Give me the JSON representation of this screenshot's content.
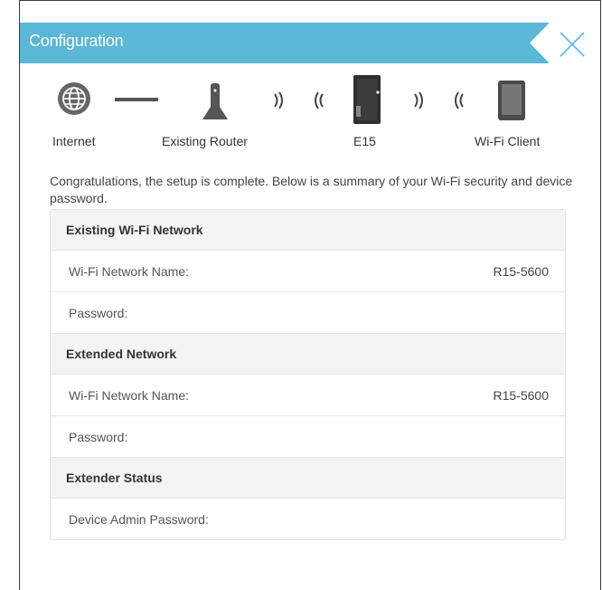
{
  "header": {
    "title": "Configuration"
  },
  "topology": {
    "labels": {
      "internet": "Internet",
      "router": "Existing Router",
      "extender": "E15",
      "client": "Wi-Fi Client"
    },
    "icons": [
      "globe-icon",
      "router-icon",
      "extender-icon",
      "tablet-icon",
      "wifi-signal-icon"
    ]
  },
  "intro": "Congratulations, the setup is complete. Below is a summary of your Wi-Fi security and device password.",
  "sections": {
    "existing": {
      "title": "Existing Wi-Fi Network",
      "name_label": "Wi-Fi Network Name:",
      "name_value": "R15-5600",
      "password_label": "Password:",
      "password_value": ""
    },
    "extended": {
      "title": "Extended Network",
      "name_label": "Wi-Fi Network Name:",
      "name_value": "R15-5600",
      "password_label": "Password:",
      "password_value": ""
    },
    "extender": {
      "title": "Extender Status",
      "admin_label": "Device Admin Password:",
      "admin_value": ""
    }
  },
  "colors": {
    "header": "#5ab7d6",
    "section_bg": "#f4f4f4"
  }
}
